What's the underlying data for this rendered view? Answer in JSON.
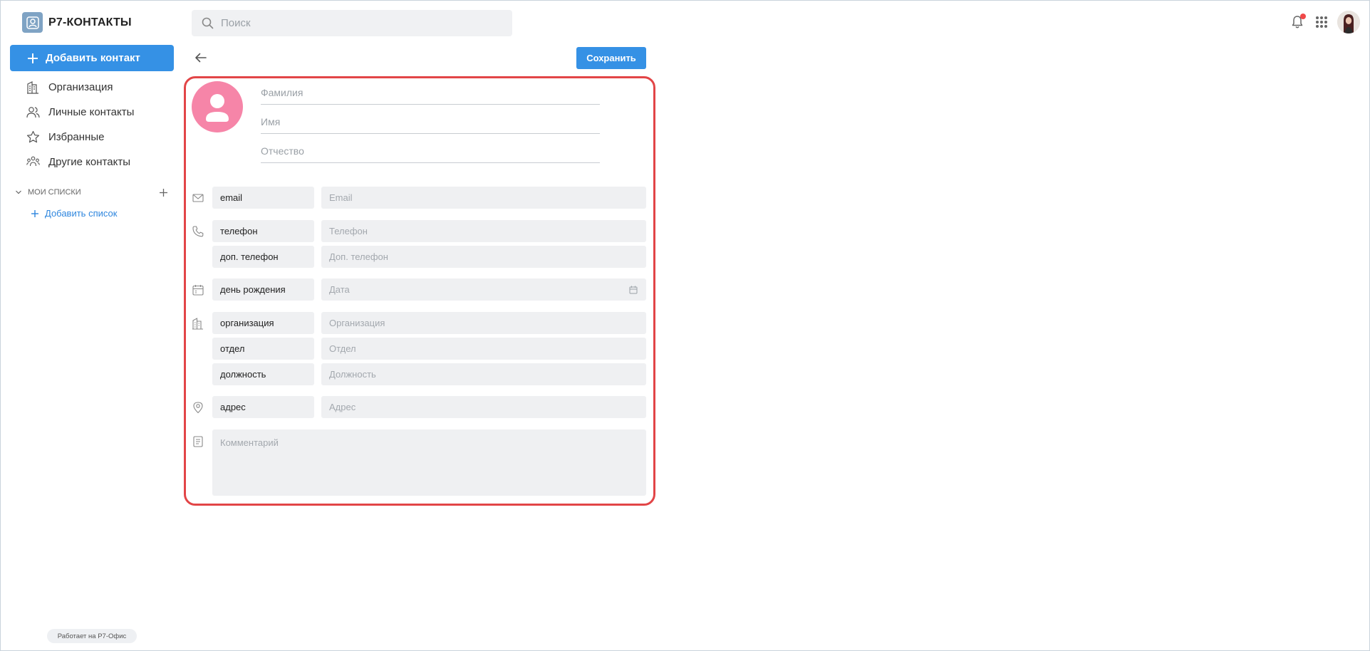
{
  "app": {
    "title": "Р7-КОНТАКТЫ"
  },
  "sidebar": {
    "add_contact_label": "Добавить контакт",
    "items": [
      {
        "label": "Организация",
        "icon": "building-icon"
      },
      {
        "label": "Личные контакты",
        "icon": "people-icon"
      },
      {
        "label": "Избранные",
        "icon": "star-icon"
      },
      {
        "label": "Другие контакты",
        "icon": "group-icon"
      }
    ],
    "lists_header": "мои списки",
    "add_list_label": "Добавить список",
    "powered_by": "Работает на Р7-Офис"
  },
  "header": {
    "search_placeholder": "Поиск",
    "notification_color": "#f04848"
  },
  "toolbar": {
    "save_label": "Сохранить"
  },
  "form": {
    "avatar_color": "#f685a8",
    "frame_color": "#e24547",
    "name_fields": {
      "last_name_placeholder": "Фамилия",
      "first_name_placeholder": "Имя",
      "middle_name_placeholder": "Отчество"
    },
    "email": {
      "label": "email",
      "placeholder": "Email"
    },
    "phone": {
      "label": "телефон",
      "placeholder": "Телефон"
    },
    "extra_phone": {
      "label": "доп. телефон",
      "placeholder": "Доп. телефон"
    },
    "birthday": {
      "label": "день рождения",
      "placeholder": "Дата"
    },
    "organization": {
      "label": "организация",
      "placeholder": "Организация"
    },
    "department": {
      "label": "отдел",
      "placeholder": "Отдел"
    },
    "position": {
      "label": "должность",
      "placeholder": "Должность"
    },
    "address": {
      "label": "адрес",
      "placeholder": "Адрес"
    },
    "comment_placeholder": "Комментарий"
  },
  "colors": {
    "accent": "#3591e5",
    "field_bg": "#eff0f2"
  }
}
